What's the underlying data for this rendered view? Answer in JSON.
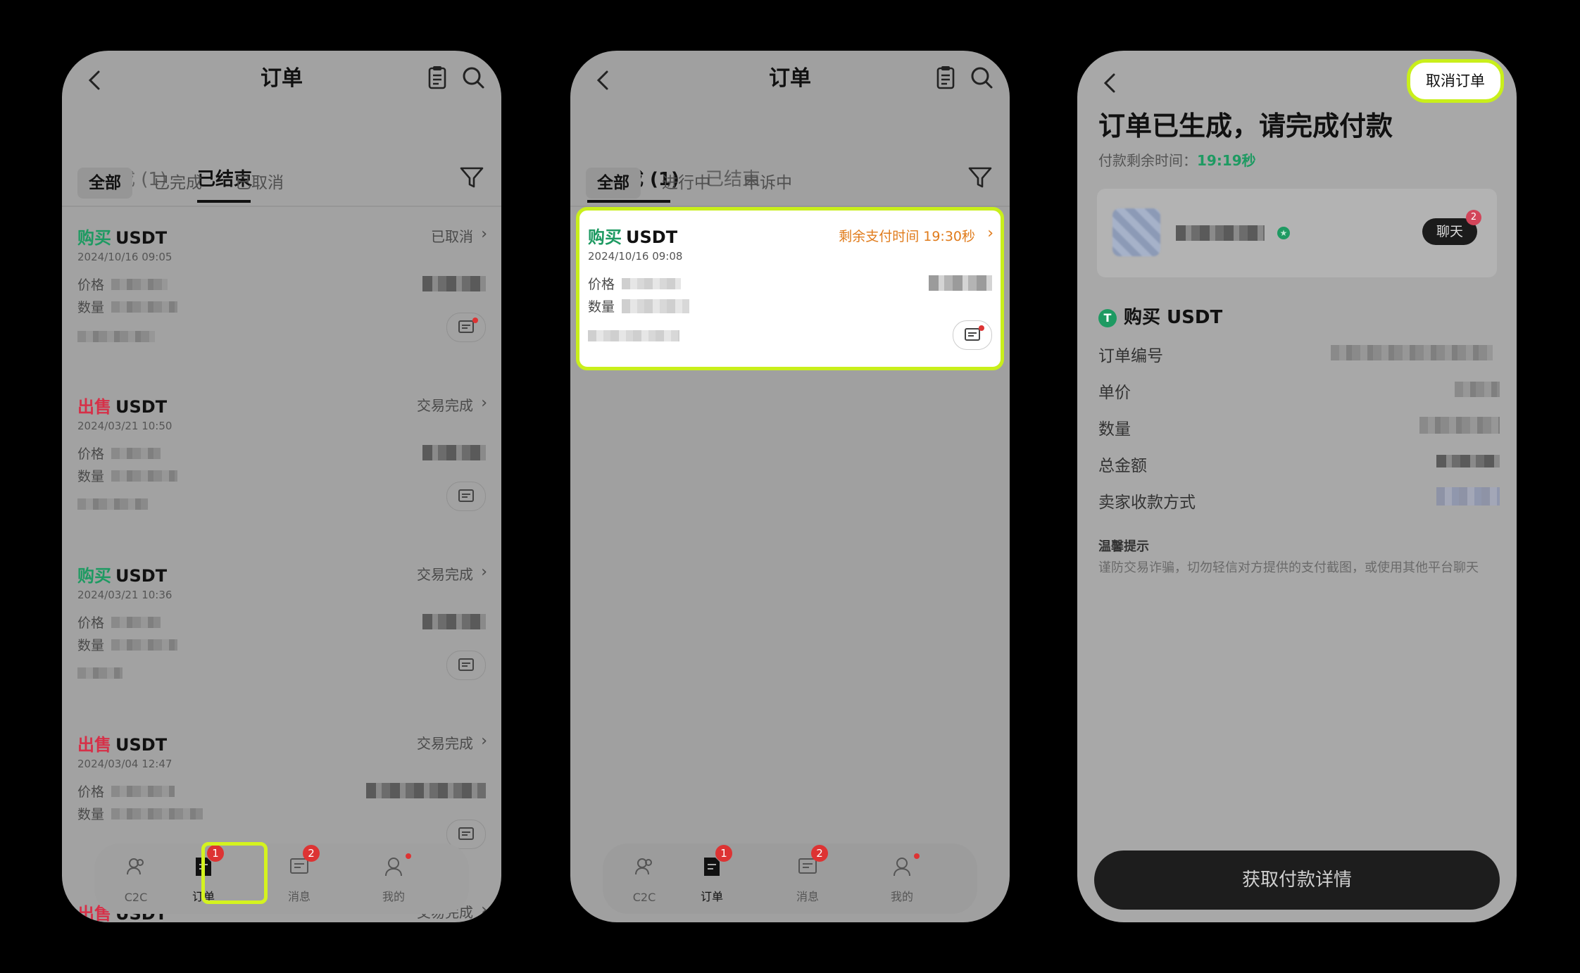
{
  "panel1": {
    "title": "订单",
    "tabs": [
      "未完成 (1)",
      "已结束"
    ],
    "subtabs": [
      "全部",
      "已完成",
      "已取消"
    ],
    "orders": [
      {
        "kind": "购买",
        "coin": "USDT",
        "status": "已取消",
        "date": "2024/10/16 09:05",
        "price_label": "价格",
        "qty_label": "数量"
      },
      {
        "kind": "出售",
        "coin": "USDT",
        "status": "交易完成",
        "date": "2024/03/21 10:50",
        "price_label": "价格",
        "qty_label": "数量"
      },
      {
        "kind": "购买",
        "coin": "USDT",
        "status": "交易完成",
        "date": "2024/03/21 10:36",
        "price_label": "价格",
        "qty_label": "数量"
      },
      {
        "kind": "出售",
        "coin": "USDT",
        "status": "交易完成",
        "date": "2024/03/04 12:47",
        "price_label": "价格",
        "qty_label": "数量"
      },
      {
        "kind": "出售",
        "coin": "USDT",
        "status": "交易完成"
      }
    ],
    "nav": [
      {
        "label": "C2C",
        "icon": "users-icon"
      },
      {
        "label": "订单",
        "icon": "order-icon",
        "badge": "1"
      },
      {
        "label": "消息",
        "icon": "message-icon",
        "badge": "2"
      },
      {
        "label": "我的",
        "icon": "profile-icon"
      }
    ]
  },
  "panel2": {
    "title": "订单",
    "tabs": [
      "未完成 (1)",
      "已结束"
    ],
    "subtabs": [
      "全部",
      "进行中",
      "申诉中"
    ],
    "order": {
      "kind": "购买",
      "coin": "USDT",
      "countdown": "剩余支付时间 19:30秒",
      "date": "2024/10/16 09:08",
      "price_label": "价格",
      "qty_label": "数量"
    },
    "nav": [
      {
        "label": "C2C"
      },
      {
        "label": "订单",
        "badge": "1"
      },
      {
        "label": "消息",
        "badge": "2"
      },
      {
        "label": "我的"
      }
    ]
  },
  "panel3": {
    "cancel": "取消订单",
    "heading": "订单已生成，请完成付款",
    "remain_label": "付款剩余时间：",
    "remain_value": "19:19秒",
    "chat": "聊天",
    "chat_badge": "2",
    "buy": "购买 USDT",
    "coin_glyph": "T",
    "rows": [
      "订单编号",
      "单价",
      "数量",
      "总金额",
      "卖家收款方式"
    ],
    "tip_title": "温馨提示",
    "tip": "谨防交易诈骗，切勿轻信对方提供的支付截图，或使用其他平台聊天",
    "pay": "获取付款详情"
  },
  "colors": {
    "buy": "#1e9a62",
    "sell": "#d63048",
    "highlight": "#c9ef1b",
    "countdown": "#e07b1b"
  }
}
